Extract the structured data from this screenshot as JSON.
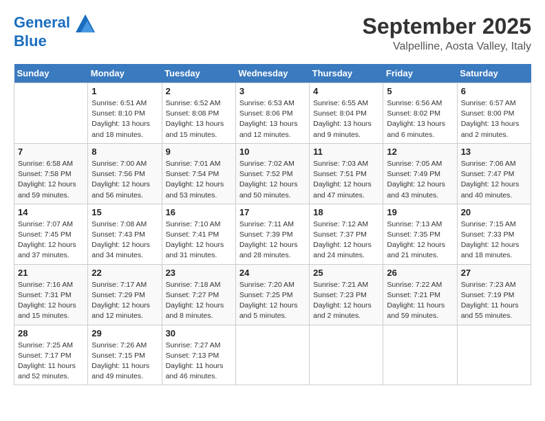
{
  "header": {
    "logo_line1": "General",
    "logo_line2": "Blue",
    "month": "September 2025",
    "location": "Valpelline, Aosta Valley, Italy"
  },
  "days_of_week": [
    "Sunday",
    "Monday",
    "Tuesday",
    "Wednesday",
    "Thursday",
    "Friday",
    "Saturday"
  ],
  "weeks": [
    [
      {
        "day": "",
        "info": ""
      },
      {
        "day": "1",
        "info": "Sunrise: 6:51 AM\nSunset: 8:10 PM\nDaylight: 13 hours\nand 18 minutes."
      },
      {
        "day": "2",
        "info": "Sunrise: 6:52 AM\nSunset: 8:08 PM\nDaylight: 13 hours\nand 15 minutes."
      },
      {
        "day": "3",
        "info": "Sunrise: 6:53 AM\nSunset: 8:06 PM\nDaylight: 13 hours\nand 12 minutes."
      },
      {
        "day": "4",
        "info": "Sunrise: 6:55 AM\nSunset: 8:04 PM\nDaylight: 13 hours\nand 9 minutes."
      },
      {
        "day": "5",
        "info": "Sunrise: 6:56 AM\nSunset: 8:02 PM\nDaylight: 13 hours\nand 6 minutes."
      },
      {
        "day": "6",
        "info": "Sunrise: 6:57 AM\nSunset: 8:00 PM\nDaylight: 13 hours\nand 2 minutes."
      }
    ],
    [
      {
        "day": "7",
        "info": "Sunrise: 6:58 AM\nSunset: 7:58 PM\nDaylight: 12 hours\nand 59 minutes."
      },
      {
        "day": "8",
        "info": "Sunrise: 7:00 AM\nSunset: 7:56 PM\nDaylight: 12 hours\nand 56 minutes."
      },
      {
        "day": "9",
        "info": "Sunrise: 7:01 AM\nSunset: 7:54 PM\nDaylight: 12 hours\nand 53 minutes."
      },
      {
        "day": "10",
        "info": "Sunrise: 7:02 AM\nSunset: 7:52 PM\nDaylight: 12 hours\nand 50 minutes."
      },
      {
        "day": "11",
        "info": "Sunrise: 7:03 AM\nSunset: 7:51 PM\nDaylight: 12 hours\nand 47 minutes."
      },
      {
        "day": "12",
        "info": "Sunrise: 7:05 AM\nSunset: 7:49 PM\nDaylight: 12 hours\nand 43 minutes."
      },
      {
        "day": "13",
        "info": "Sunrise: 7:06 AM\nSunset: 7:47 PM\nDaylight: 12 hours\nand 40 minutes."
      }
    ],
    [
      {
        "day": "14",
        "info": "Sunrise: 7:07 AM\nSunset: 7:45 PM\nDaylight: 12 hours\nand 37 minutes."
      },
      {
        "day": "15",
        "info": "Sunrise: 7:08 AM\nSunset: 7:43 PM\nDaylight: 12 hours\nand 34 minutes."
      },
      {
        "day": "16",
        "info": "Sunrise: 7:10 AM\nSunset: 7:41 PM\nDaylight: 12 hours\nand 31 minutes."
      },
      {
        "day": "17",
        "info": "Sunrise: 7:11 AM\nSunset: 7:39 PM\nDaylight: 12 hours\nand 28 minutes."
      },
      {
        "day": "18",
        "info": "Sunrise: 7:12 AM\nSunset: 7:37 PM\nDaylight: 12 hours\nand 24 minutes."
      },
      {
        "day": "19",
        "info": "Sunrise: 7:13 AM\nSunset: 7:35 PM\nDaylight: 12 hours\nand 21 minutes."
      },
      {
        "day": "20",
        "info": "Sunrise: 7:15 AM\nSunset: 7:33 PM\nDaylight: 12 hours\nand 18 minutes."
      }
    ],
    [
      {
        "day": "21",
        "info": "Sunrise: 7:16 AM\nSunset: 7:31 PM\nDaylight: 12 hours\nand 15 minutes."
      },
      {
        "day": "22",
        "info": "Sunrise: 7:17 AM\nSunset: 7:29 PM\nDaylight: 12 hours\nand 12 minutes."
      },
      {
        "day": "23",
        "info": "Sunrise: 7:18 AM\nSunset: 7:27 PM\nDaylight: 12 hours\nand 8 minutes."
      },
      {
        "day": "24",
        "info": "Sunrise: 7:20 AM\nSunset: 7:25 PM\nDaylight: 12 hours\nand 5 minutes."
      },
      {
        "day": "25",
        "info": "Sunrise: 7:21 AM\nSunset: 7:23 PM\nDaylight: 12 hours\nand 2 minutes."
      },
      {
        "day": "26",
        "info": "Sunrise: 7:22 AM\nSunset: 7:21 PM\nDaylight: 11 hours\nand 59 minutes."
      },
      {
        "day": "27",
        "info": "Sunrise: 7:23 AM\nSunset: 7:19 PM\nDaylight: 11 hours\nand 55 minutes."
      }
    ],
    [
      {
        "day": "28",
        "info": "Sunrise: 7:25 AM\nSunset: 7:17 PM\nDaylight: 11 hours\nand 52 minutes."
      },
      {
        "day": "29",
        "info": "Sunrise: 7:26 AM\nSunset: 7:15 PM\nDaylight: 11 hours\nand 49 minutes."
      },
      {
        "day": "30",
        "info": "Sunrise: 7:27 AM\nSunset: 7:13 PM\nDaylight: 11 hours\nand 46 minutes."
      },
      {
        "day": "",
        "info": ""
      },
      {
        "day": "",
        "info": ""
      },
      {
        "day": "",
        "info": ""
      },
      {
        "day": "",
        "info": ""
      }
    ]
  ]
}
